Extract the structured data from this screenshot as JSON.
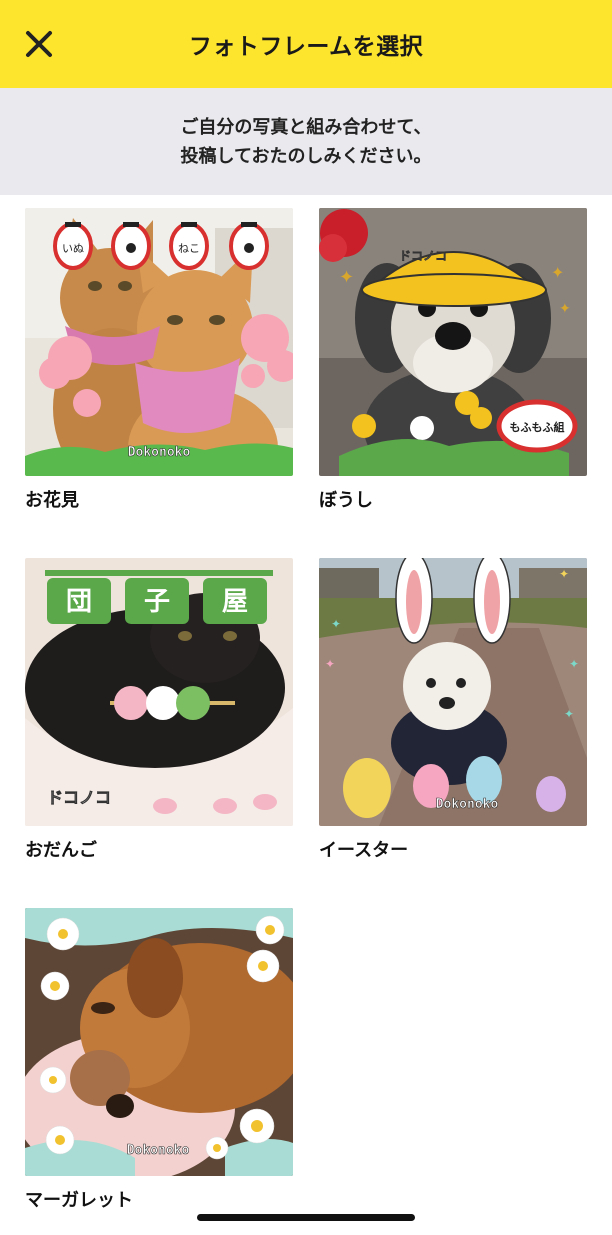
{
  "header": {
    "title": "フォトフレームを選択",
    "close_icon": "close-icon",
    "background": "#fde42d"
  },
  "intro": {
    "line1": "ご自分の写真と組み合わせて、",
    "line2": "投稿しておたのしみください。"
  },
  "frames": [
    {
      "label": "お花見",
      "stamp": "Dokonoko",
      "lanterns": [
        "いぬ",
        "肉球",
        "ねこ",
        "肉球"
      ]
    },
    {
      "label": "ぼうし",
      "stamp": "ドコノコ",
      "badge": "もふもふ組"
    },
    {
      "label": "おだんご",
      "stamp": "ドコノコ",
      "banner": [
        "団",
        "子",
        "屋"
      ]
    },
    {
      "label": "イースター",
      "stamp": "Dokonoko"
    },
    {
      "label": "マーガレット",
      "stamp": "Dokonoko"
    }
  ]
}
